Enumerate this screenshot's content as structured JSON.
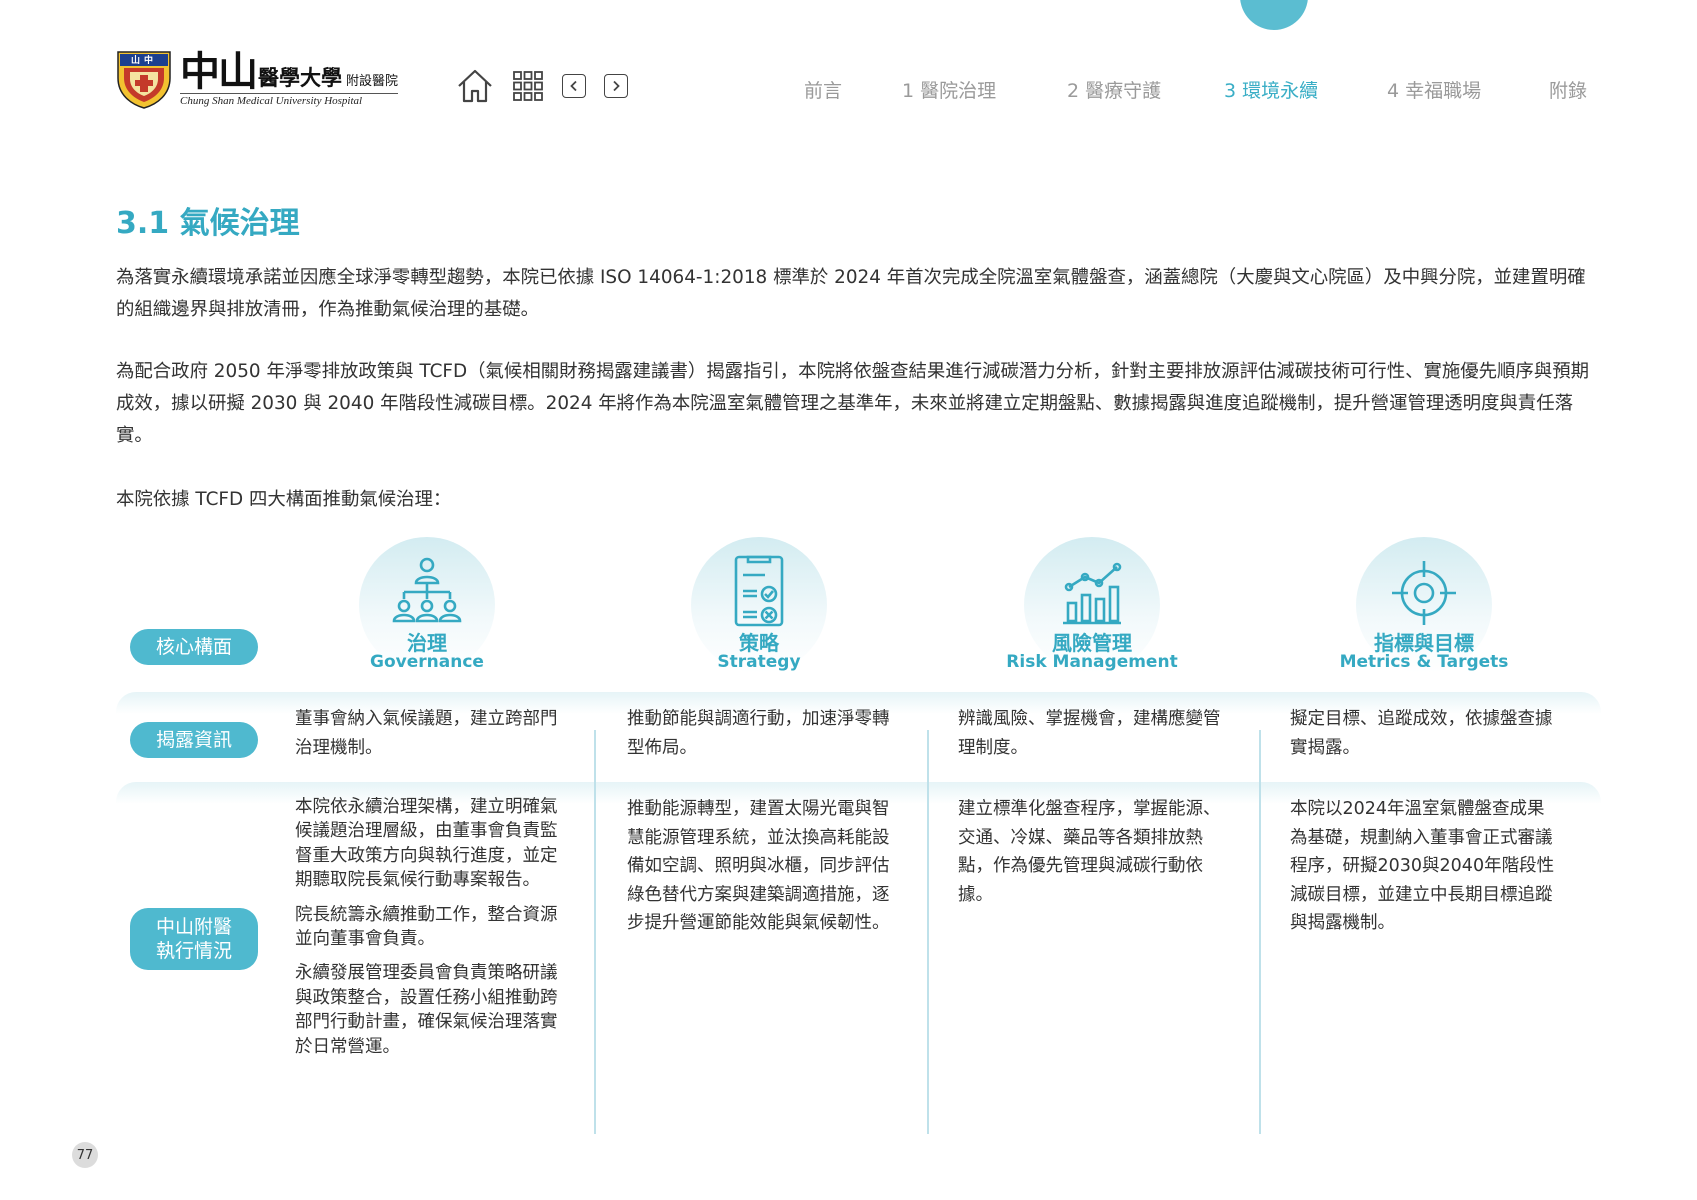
{
  "header": {
    "logo": {
      "seal_text": "山中",
      "name_big": "中山",
      "name_mid": "醫學大學",
      "name_small": "附設醫院",
      "name_en": "Chung Shan Medical University Hospital"
    },
    "icons": [
      "home-icon",
      "grid-icon",
      "chevron-left-icon",
      "chevron-right-icon"
    ],
    "menu": [
      {
        "label": "前言"
      },
      {
        "label": "1 醫院治理"
      },
      {
        "label": "2 醫療守護"
      },
      {
        "label": "3 環境永續"
      },
      {
        "label": "4 幸福職場"
      },
      {
        "label": "附錄"
      }
    ],
    "active_menu": "3 環境永續",
    "accent_color": "#35a9c2"
  },
  "section": {
    "title": "3.1 氣候治理",
    "paragraphs": [
      "為落實永續環境承諾並因應全球淨零轉型趨勢，本院已依據 ISO 14064-1:2018 標準於 2024 年首次完成全院溫室氣體盤查，涵蓋總院（大慶與文心院區）及中興分院，並建置明確的組織邊界與排放清冊，作為推動氣候治理的基礎。",
      "為配合政府 2050 年淨零排放政策與 TCFD（氣候相關財務揭露建議書）揭露指引，本院將依盤查結果進行減碳潛力分析，針對主要排放源評估減碳技術可行性、實施優先順序與預期成效，據以研擬 2030 與 2040 年階段性減碳目標。2024 年將作為本院溫室氣體管理之基準年，未來並將建立定期盤點、數據揭露與進度追蹤機制，提升營運管理透明度與責任落實。",
      "本院依據 TCFD 四大構面推動氣候治理："
    ]
  },
  "tcfd": {
    "row_labels": {
      "core": "核心構面",
      "disclosure": "揭露資訊",
      "execution_line1": "中山附醫",
      "execution_line2": "執行情況"
    },
    "pillars": [
      {
        "icon": "org-chart-icon",
        "title_cn": "治理",
        "title_en": "Governance",
        "disclosure": "董事會納入氣候議題，建立跨部門治理機制。",
        "execution": [
          "本院依永續治理架構，建立明確氣候議題治理層級，由董事會負責監督重大政策方向與執行進度，並定期聽取院長氣候行動專案報告。",
          "院長統籌永續推動工作，整合資源並向董事會負責。",
          "永續發展管理委員會負責策略研議與政策整合，設置任務小組推動跨部門行動計畫，確保氣候治理落實於日常營運。"
        ]
      },
      {
        "icon": "checklist-icon",
        "title_cn": "策略",
        "title_en": "Strategy",
        "disclosure": "推動節能與調適行動，加速淨零轉型佈局。",
        "execution": [
          "推動能源轉型，建置太陽光電與智慧能源管理系統，並汰換高耗能設備如空調、照明與冰櫃，同步評估綠色替代方案與建築調適措施，逐步提升營運節能效能與氣候韌性。"
        ]
      },
      {
        "icon": "bar-chart-icon",
        "title_cn": "風險管理",
        "title_en": "Risk Management",
        "disclosure": "辨識風險、掌握機會，建構應變管理制度。",
        "execution": [
          "建立標準化盤查程序，掌握能源、交通、冷媒、藥品等各類排放熱點，作為優先管理與減碳行動依據。"
        ]
      },
      {
        "icon": "target-icon",
        "title_cn": "指標與目標",
        "title_en": "Metrics & Targets",
        "disclosure": "擬定目標、追蹤成效，依據盤查據實揭露。",
        "execution": [
          "本院以2024年溫室氣體盤查成果為基礎，規劃納入董事會正式審議程序，研擬2030與2040年階段性減碳目標，並建立中長期目標追蹤與揭露機制。"
        ]
      }
    ]
  },
  "footer": {
    "page_number": "77"
  }
}
